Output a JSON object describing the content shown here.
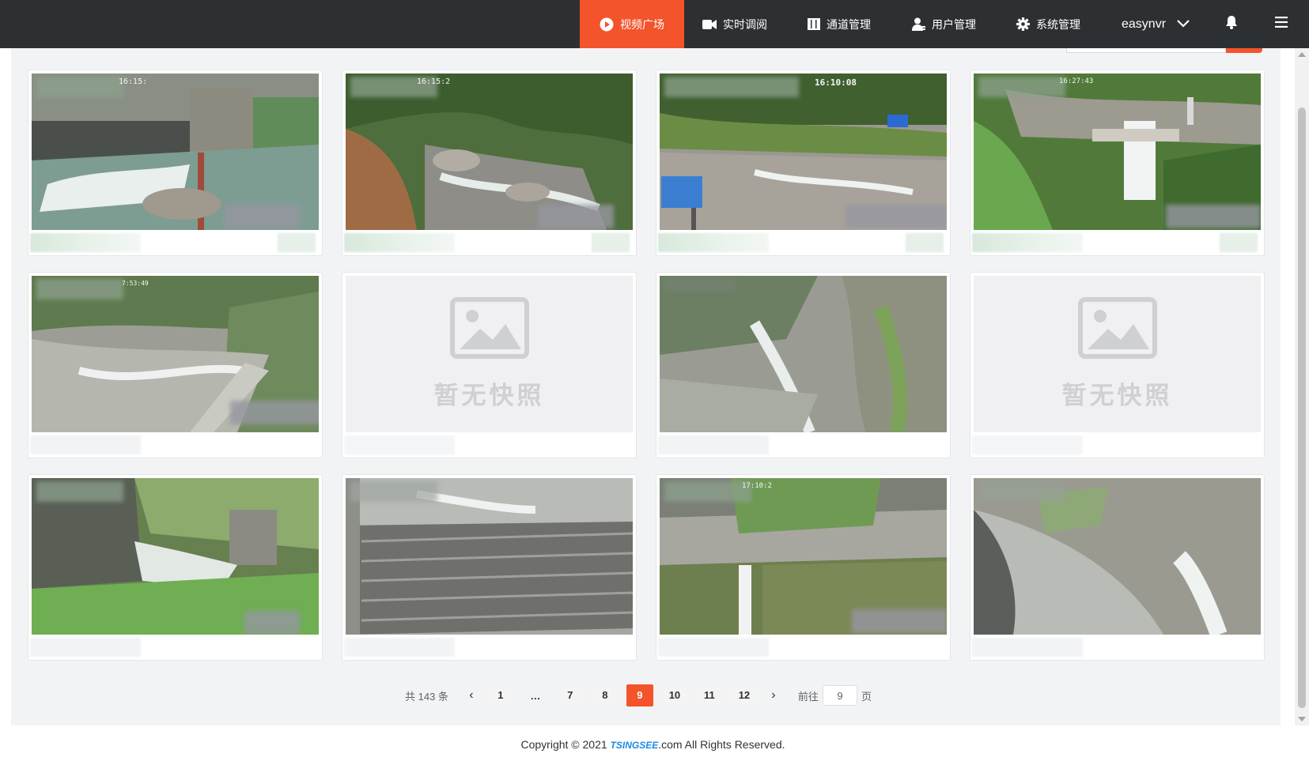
{
  "nav": {
    "items": [
      {
        "label": "视频广场",
        "icon": "play-circle-icon",
        "active": true
      },
      {
        "label": "实时调阅",
        "icon": "video-camera-icon",
        "active": false
      },
      {
        "label": "通道管理",
        "icon": "columns-icon",
        "active": false
      },
      {
        "label": "用户管理",
        "icon": "users-icon",
        "active": false
      },
      {
        "label": "系统管理",
        "icon": "gear-icon",
        "active": false
      }
    ],
    "username": "easynvr",
    "icons": {
      "user_menu": "chevron-down-icon",
      "bell": "bell-icon",
      "menu": "hamburger-menu-icon"
    },
    "accent_color": "#f3542b",
    "bar_color": "#2d3033"
  },
  "cards": [
    {
      "type": "snapshot",
      "osd_time": "16:15:"
    },
    {
      "type": "snapshot",
      "osd_time": "16:15:2"
    },
    {
      "type": "snapshot",
      "osd_time": "16:10:08"
    },
    {
      "type": "snapshot",
      "osd_time": "16:27:43"
    },
    {
      "type": "snapshot",
      "osd_time": "7:53:49"
    },
    {
      "type": "empty",
      "placeholder": "暂无快照"
    },
    {
      "type": "snapshot",
      "osd_time": ""
    },
    {
      "type": "empty",
      "placeholder": "暂无快照"
    },
    {
      "type": "snapshot",
      "osd_time": ""
    },
    {
      "type": "snapshot",
      "osd_time": ""
    },
    {
      "type": "snapshot",
      "osd_time": "17:10:2"
    },
    {
      "type": "snapshot",
      "osd_time": ""
    }
  ],
  "pagination": {
    "total_text": "共 143 条",
    "prev": "‹",
    "next": "›",
    "pages": [
      "1",
      "…",
      "7",
      "8",
      "9",
      "10",
      "11",
      "12"
    ],
    "current": "9",
    "goto_label": "前往",
    "goto_value": "9",
    "goto_suffix": "页"
  },
  "footer": {
    "prefix": "Copyright © 2021 ",
    "brand": "TSINGSEE",
    "suffix": ".com All Rights Reserved."
  }
}
